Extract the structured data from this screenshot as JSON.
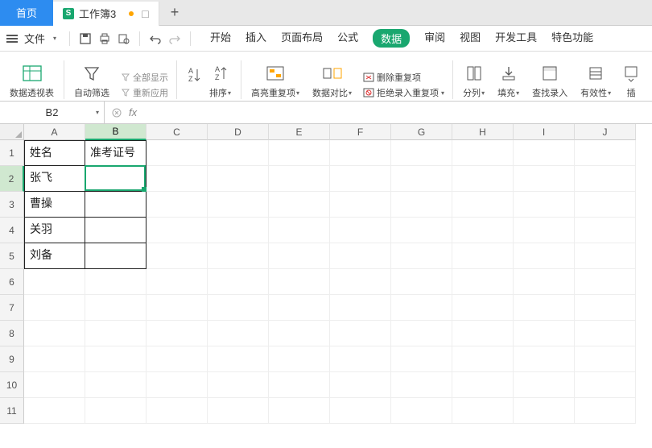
{
  "tabs": {
    "home": "首页",
    "doc": "工作簿3"
  },
  "menu": {
    "file": "文件",
    "items": [
      "开始",
      "插入",
      "页面布局",
      "公式",
      "数据",
      "审阅",
      "视图",
      "开发工具",
      "特色功能"
    ],
    "active_index": 4
  },
  "ribbon": {
    "pivot": "数据透视表",
    "autofilter": "自动筛选",
    "showall": "全部显示",
    "reapply": "重新应用",
    "sort": "排序",
    "highlight_dup": "高亮重复项",
    "data_compare": "数据对比",
    "del_dup": "删除重复项",
    "reject_dup": "拒绝录入重复项",
    "split": "分列",
    "fill": "填充",
    "lookup": "查找录入",
    "validity": "有效性",
    "insert_partial": "插"
  },
  "namebox": "B2",
  "columns": [
    "A",
    "B",
    "C",
    "D",
    "E",
    "F",
    "G",
    "H",
    "I",
    "J"
  ],
  "selected_col_index": 1,
  "selected_row_index": 1,
  "row_count": 11,
  "cells": {
    "A1": "姓名",
    "B1": "准考证号",
    "A2": "张飞",
    "A3": "曹操",
    "A4": "关羽",
    "A5": "刘备"
  },
  "chart_data": {
    "type": "table",
    "columns": [
      "姓名",
      "准考证号"
    ],
    "rows": [
      {
        "姓名": "张飞",
        "准考证号": ""
      },
      {
        "姓名": "曹操",
        "准考证号": ""
      },
      {
        "姓名": "关羽",
        "准考证号": ""
      },
      {
        "姓名": "刘备",
        "准考证号": ""
      }
    ]
  },
  "active_cell": "B2"
}
